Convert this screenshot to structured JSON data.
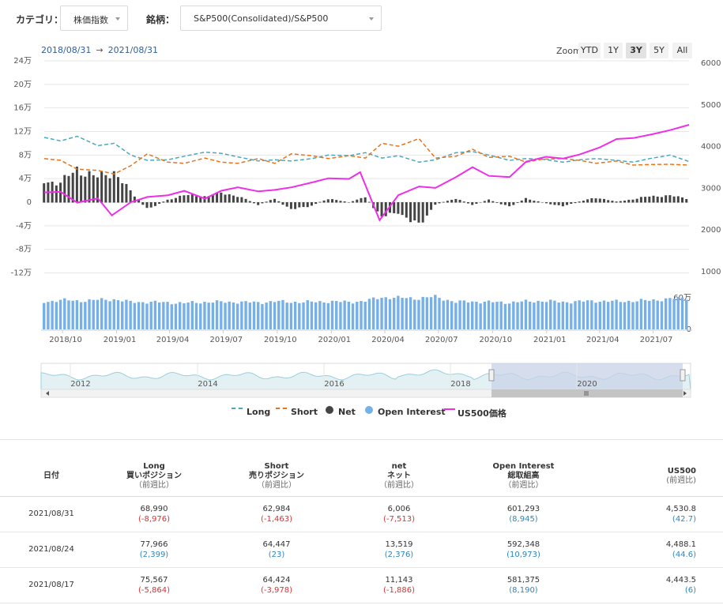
{
  "filters": {
    "category_label": "カテゴリ：",
    "category_value": "株価指数",
    "symbol_label": "銘柄：",
    "symbol_value": "S&P500(Consolidated)/S&P500"
  },
  "range": {
    "from": "2018/08/31",
    "arrow": "→",
    "to": "2021/08/31"
  },
  "zoom": {
    "label": "Zoom",
    "buttons": [
      "YTD",
      "1Y",
      "3Y",
      "5Y",
      "All"
    ],
    "active": "3Y"
  },
  "colors": {
    "long": "#4aa8c0",
    "short": "#e8741c",
    "net": "#444444",
    "oi": "#76b0e8",
    "price": "#ee2ee8",
    "nav_fill": "#c8d3e8"
  },
  "chart_data": {
    "type": "line",
    "left_axis": {
      "ticks": [
        "24万",
        "20万",
        "16万",
        "12万",
        "8万",
        "4万",
        "0",
        "-4万",
        "-8万",
        "-12万"
      ],
      "values": [
        240000,
        200000,
        160000,
        120000,
        80000,
        40000,
        0,
        -40000,
        -80000,
        -120000
      ]
    },
    "right_axis": {
      "ticks": [
        "6000",
        "5000",
        "4000",
        "3000",
        "2000",
        "1000"
      ],
      "values": [
        6000,
        5000,
        4000,
        3000,
        2000,
        1000
      ]
    },
    "oi_axis": {
      "ticks": [
        "60万",
        "0"
      ],
      "values": [
        600000,
        0
      ]
    },
    "x_axis": [
      "2018/10",
      "2019/01",
      "2019/04",
      "2019/07",
      "2019/10",
      "2020/01",
      "2020/04",
      "2020/07",
      "2020/10",
      "2021/01",
      "2021/04",
      "2021/07"
    ],
    "navigator_labels": [
      "2012",
      "2014",
      "2016",
      "2018",
      "2020"
    ],
    "series": [
      {
        "name": "Long",
        "color": "#4aa8c0",
        "dash": "5,3",
        "points": [
          [
            "2018/08/31",
            110000
          ],
          [
            "2018/09/28",
            104000
          ],
          [
            "2018/10/26",
            112000
          ],
          [
            "2018/11/30",
            96000
          ],
          [
            "2018/12/28",
            100000
          ],
          [
            "2019/01/25",
            80000
          ],
          [
            "2019/02/22",
            71000
          ],
          [
            "2019/03/29",
            72000
          ],
          [
            "2019/04/26",
            78000
          ],
          [
            "2019/05/31",
            85000
          ],
          [
            "2019/06/28",
            83000
          ],
          [
            "2019/07/26",
            77000
          ],
          [
            "2019/08/30",
            70000
          ],
          [
            "2019/09/27",
            72000
          ],
          [
            "2019/10/25",
            70000
          ],
          [
            "2019/11/29",
            74000
          ],
          [
            "2019/12/27",
            80000
          ],
          [
            "2020/01/31",
            79000
          ],
          [
            "2020/02/28",
            84000
          ],
          [
            "2020/03/27",
            75000
          ],
          [
            "2020/04/24",
            79000
          ],
          [
            "2020/05/29",
            68000
          ],
          [
            "2020/06/26",
            72000
          ],
          [
            "2020/07/31",
            84000
          ],
          [
            "2020/08/28",
            86000
          ],
          [
            "2020/09/25",
            80000
          ],
          [
            "2020/10/30",
            71000
          ],
          [
            "2020/11/27",
            74000
          ],
          [
            "2020/12/25",
            73000
          ],
          [
            "2021/01/29",
            68000
          ],
          [
            "2021/02/26",
            72000
          ],
          [
            "2021/03/26",
            74000
          ],
          [
            "2021/04/30",
            71000
          ],
          [
            "2021/05/28",
            68000
          ],
          [
            "2021/06/25",
            74000
          ],
          [
            "2021/07/30",
            80000
          ],
          [
            "2021/08/31",
            68990
          ]
        ]
      },
      {
        "name": "Short",
        "color": "#e8741c",
        "dash": "5,3",
        "points": [
          [
            "2018/08/31",
            74000
          ],
          [
            "2018/09/28",
            71000
          ],
          [
            "2018/10/26",
            56000
          ],
          [
            "2018/11/30",
            54000
          ],
          [
            "2018/12/28",
            48000
          ],
          [
            "2019/01/25",
            62000
          ],
          [
            "2019/02/22",
            82000
          ],
          [
            "2019/03/29",
            68000
          ],
          [
            "2019/04/26",
            66000
          ],
          [
            "2019/05/31",
            75000
          ],
          [
            "2019/06/28",
            68000
          ],
          [
            "2019/07/26",
            66000
          ],
          [
            "2019/08/30",
            74000
          ],
          [
            "2019/09/27",
            66000
          ],
          [
            "2019/10/25",
            82000
          ],
          [
            "2019/11/29",
            79000
          ],
          [
            "2019/12/27",
            74000
          ],
          [
            "2020/01/31",
            79000
          ],
          [
            "2020/02/28",
            75000
          ],
          [
            "2020/03/27",
            100000
          ],
          [
            "2020/04/24",
            95000
          ],
          [
            "2020/05/29",
            108000
          ],
          [
            "2020/06/26",
            75000
          ],
          [
            "2020/07/31",
            78000
          ],
          [
            "2020/08/28",
            90000
          ],
          [
            "2020/09/25",
            76000
          ],
          [
            "2020/10/30",
            78000
          ],
          [
            "2020/11/27",
            68000
          ],
          [
            "2020/12/25",
            73000
          ],
          [
            "2021/01/29",
            74000
          ],
          [
            "2021/02/26",
            71000
          ],
          [
            "2021/03/26",
            66000
          ],
          [
            "2021/04/30",
            70000
          ],
          [
            "2021/05/28",
            63000
          ],
          [
            "2021/06/25",
            64000
          ],
          [
            "2021/07/30",
            64424
          ],
          [
            "2021/08/31",
            62984
          ]
        ]
      },
      {
        "name": "US500価格",
        "color": "#ee2ee8",
        "axis": "right",
        "points": [
          [
            "2018/08/31",
            2901
          ],
          [
            "2018/09/28",
            2914
          ],
          [
            "2018/10/26",
            2658
          ],
          [
            "2018/11/30",
            2760
          ],
          [
            "2018/12/24",
            2351
          ],
          [
            "2019/01/25",
            2665
          ],
          [
            "2019/02/22",
            2792
          ],
          [
            "2019/03/29",
            2834
          ],
          [
            "2019/04/26",
            2940
          ],
          [
            "2019/05/31",
            2752
          ],
          [
            "2019/06/28",
            2942
          ],
          [
            "2019/07/26",
            3025
          ],
          [
            "2019/08/30",
            2926
          ],
          [
            "2019/09/27",
            2962
          ],
          [
            "2019/10/25",
            3023
          ],
          [
            "2019/11/29",
            3141
          ],
          [
            "2019/12/27",
            3240
          ],
          [
            "2020/01/31",
            3226
          ],
          [
            "2020/02/19",
            3386
          ],
          [
            "2020/03/23",
            2237
          ],
          [
            "2020/04/24",
            2837
          ],
          [
            "2020/05/29",
            3044
          ],
          [
            "2020/06/26",
            3009
          ],
          [
            "2020/07/31",
            3271
          ],
          [
            "2020/08/28",
            3508
          ],
          [
            "2020/09/25",
            3298
          ],
          [
            "2020/10/30",
            3270
          ],
          [
            "2020/11/27",
            3638
          ],
          [
            "2020/12/31",
            3756
          ],
          [
            "2021/01/29",
            3714
          ],
          [
            "2021/02/26",
            3811
          ],
          [
            "2021/03/31",
            3973
          ],
          [
            "2021/04/30",
            4181
          ],
          [
            "2021/05/28",
            4204
          ],
          [
            "2021/06/30",
            4298
          ],
          [
            "2021/07/30",
            4395
          ],
          [
            "2021/08/31",
            4522
          ]
        ]
      },
      {
        "name": "Net",
        "type": "bar",
        "color": "#444444",
        "points": [
          [
            "2018/08/31",
            36000
          ],
          [
            "2018/09/28",
            33000
          ],
          [
            "2018/10/26",
            56000
          ],
          [
            "2018/11/30",
            42000
          ],
          [
            "2018/12/28",
            52000
          ],
          [
            "2019/01/25",
            18000
          ],
          [
            "2019/02/22",
            -11000
          ],
          [
            "2019/03/29",
            4000
          ],
          [
            "2019/04/26",
            12000
          ],
          [
            "2019/05/31",
            10000
          ],
          [
            "2019/06/28",
            15000
          ],
          [
            "2019/07/26",
            11000
          ],
          [
            "2019/08/30",
            -4000
          ],
          [
            "2019/09/27",
            6000
          ],
          [
            "2019/10/25",
            -12000
          ],
          [
            "2019/11/29",
            -5000
          ],
          [
            "2019/12/27",
            6000
          ],
          [
            "2020/01/31",
            0
          ],
          [
            "2020/02/28",
            9000
          ],
          [
            "2020/03/27",
            -25000
          ],
          [
            "2020/04/24",
            -16000
          ],
          [
            "2020/05/29",
            -40000
          ],
          [
            "2020/06/26",
            -3000
          ],
          [
            "2020/07/31",
            6000
          ],
          [
            "2020/08/28",
            -4000
          ],
          [
            "2020/09/25",
            4000
          ],
          [
            "2020/10/30",
            -7000
          ],
          [
            "2020/11/27",
            6000
          ],
          [
            "2020/12/25",
            0
          ],
          [
            "2021/01/29",
            -6000
          ],
          [
            "2021/02/26",
            1000
          ],
          [
            "2021/03/26",
            8000
          ],
          [
            "2021/04/30",
            1000
          ],
          [
            "2021/05/28",
            5000
          ],
          [
            "2021/06/25",
            10000
          ],
          [
            "2021/07/30",
            11143
          ],
          [
            "2021/08/31",
            6006
          ]
        ]
      },
      {
        "name": "Open Interest",
        "type": "bar",
        "color": "#76b0e8",
        "points": [
          [
            "2018/08/31",
            520000
          ],
          [
            "2018/09/28",
            560000
          ],
          [
            "2018/10/26",
            540000
          ],
          [
            "2018/11/30",
            560000
          ],
          [
            "2018/12/28",
            570000
          ],
          [
            "2019/01/25",
            520000
          ],
          [
            "2019/02/22",
            520000
          ],
          [
            "2019/03/29",
            510000
          ],
          [
            "2019/04/26",
            500000
          ],
          [
            "2019/05/31",
            520000
          ],
          [
            "2019/06/28",
            520000
          ],
          [
            "2019/07/26",
            520000
          ],
          [
            "2019/08/30",
            510000
          ],
          [
            "2019/09/27",
            530000
          ],
          [
            "2019/10/25",
            520000
          ],
          [
            "2019/11/29",
            520000
          ],
          [
            "2019/12/27",
            530000
          ],
          [
            "2020/01/31",
            520000
          ],
          [
            "2020/02/28",
            540000
          ],
          [
            "2020/03/27",
            610000
          ],
          [
            "2020/04/24",
            600000
          ],
          [
            "2020/05/29",
            590000
          ],
          [
            "2020/06/26",
            620000
          ],
          [
            "2020/07/31",
            520000
          ],
          [
            "2020/08/28",
            530000
          ],
          [
            "2020/09/25",
            520000
          ],
          [
            "2020/10/30",
            510000
          ],
          [
            "2020/11/27",
            530000
          ],
          [
            "2020/12/25",
            540000
          ],
          [
            "2021/01/29",
            520000
          ],
          [
            "2021/02/26",
            530000
          ],
          [
            "2021/03/26",
            540000
          ],
          [
            "2021/04/30",
            530000
          ],
          [
            "2021/05/28",
            540000
          ],
          [
            "2021/06/25",
            550000
          ],
          [
            "2021/07/30",
            581375
          ],
          [
            "2021/08/31",
            601293
          ]
        ]
      }
    ]
  },
  "legend": [
    {
      "name": "Long",
      "symbol": "dash",
      "color": "#4aa8c0"
    },
    {
      "name": "Short",
      "symbol": "dash",
      "color": "#e8741c"
    },
    {
      "name": "Net",
      "symbol": "dot",
      "color": "#444444"
    },
    {
      "name": "Open Interest",
      "symbol": "dot",
      "color": "#76b0e8"
    },
    {
      "name": "US500価格",
      "symbol": "line",
      "color": "#ee2ee8"
    }
  ],
  "table": {
    "headers": [
      {
        "l1": "日付"
      },
      {
        "l1": "Long",
        "l2": "買いポジション",
        "l3": "（前週比）"
      },
      {
        "l1": "Short",
        "l2": "売りポジション",
        "l3": "（前週比）"
      },
      {
        "l1": "net",
        "l2": "ネット",
        "l3": "（前週比）"
      },
      {
        "l1": "Open Interest",
        "l2": "総取組高",
        "l3": "（前週比）"
      },
      {
        "l1": "US500",
        "l3": "(前週比)"
      }
    ],
    "rows": [
      {
        "date": "2021/08/31",
        "long": "68,990",
        "long_chg": "(-8,976)",
        "short": "62,984",
        "short_chg": "(-1,463)",
        "net": "6,006",
        "net_chg": "(-7,513)",
        "oi": "601,293",
        "oi_chg": "(8,945)",
        "us": "4,530.8",
        "us_chg": "(42.7)"
      },
      {
        "date": "2021/08/24",
        "long": "77,966",
        "long_chg": "(2,399)",
        "short": "64,447",
        "short_chg": "(23)",
        "net": "13,519",
        "net_chg": "(2,376)",
        "oi": "592,348",
        "oi_chg": "(10,973)",
        "us": "4,488.1",
        "us_chg": "(44.6)"
      },
      {
        "date": "2021/08/17",
        "long": "75,567",
        "long_chg": "(-5,864)",
        "short": "64,424",
        "short_chg": "(-3,978)",
        "net": "11,143",
        "net_chg": "(-1,886)",
        "oi": "581,375",
        "oi_chg": "(8,190)",
        "us": "4,443.5",
        "us_chg": "(6)"
      }
    ]
  }
}
